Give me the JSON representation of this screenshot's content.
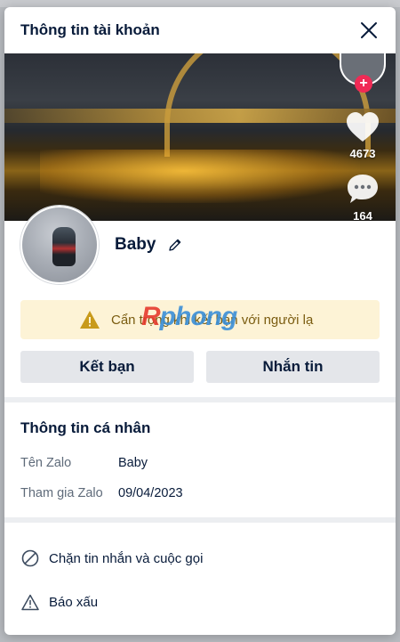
{
  "modal": {
    "title": "Thông tin tài khoản"
  },
  "cover": {
    "likes": "4673",
    "comments": "164"
  },
  "profile": {
    "name": "Baby"
  },
  "warning": {
    "text": "Cẩn trọng khi kết bạn với người lạ"
  },
  "watermark": {
    "brand_r": "R",
    "brand_rest": "phong"
  },
  "actions": {
    "add_friend": "Kết bạn",
    "message": "Nhắn tin"
  },
  "personal_info": {
    "title": "Thông tin cá nhân",
    "rows": [
      {
        "label": "Tên Zalo",
        "value": "Baby"
      },
      {
        "label": "Tham gia Zalo",
        "value": "09/04/2023"
      }
    ]
  },
  "menu": {
    "block": "Chặn tin nhắn và cuộc gọi",
    "report": "Báo xấu"
  },
  "colors": {
    "accent_text": "#081b3a",
    "warning_bg": "#fdf3d6",
    "warning_icon": "#c89a1a",
    "badge_red": "#f02a55"
  }
}
